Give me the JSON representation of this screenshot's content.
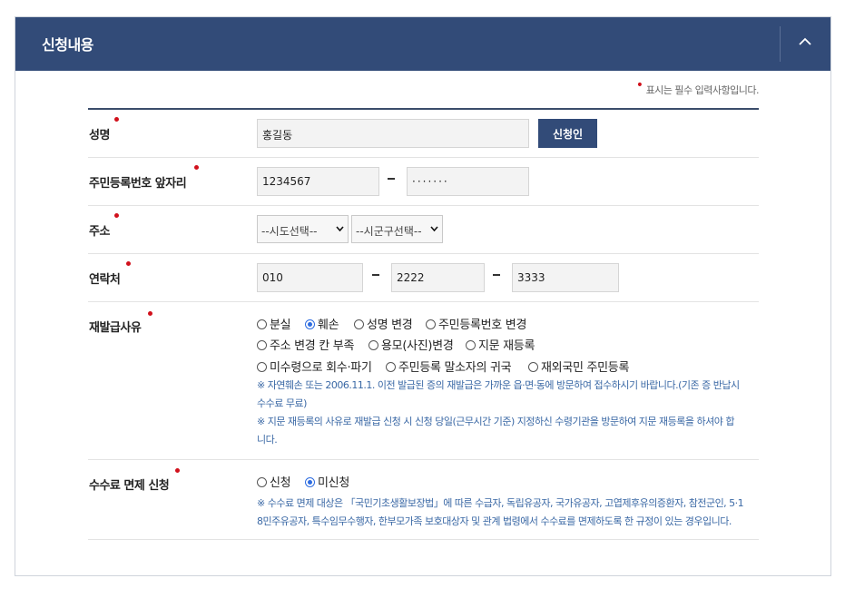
{
  "panel": {
    "title": "신청내용"
  },
  "required_note": "표시는 필수 입력사항입니다.",
  "fields": {
    "name": {
      "label": "성명",
      "value": "홍길동",
      "button": "신청인"
    },
    "rrn": {
      "label": "주민등록번호 앞자리",
      "front": "1234567",
      "back": "·······"
    },
    "address": {
      "label": "주소",
      "sido": "--시도선택--",
      "sigungu": "--시군구선택--"
    },
    "contact": {
      "label": "연락처",
      "part1": "010",
      "part2": "2222",
      "part3": "3333"
    },
    "reason": {
      "label": "재발급사유",
      "options": [
        "분실",
        "훼손",
        "성명 변경",
        "주민등록번호 변경",
        "주소 변경 칸 부족",
        "용모(사진)변경",
        "지문 재등록",
        "미수령으로 회수·파기",
        "주민등록 말소자의 귀국",
        "재외국민 주민등록"
      ],
      "selected": "훼손",
      "note1_line1": "※ 자연훼손 또는 2006.11.1. 이전 발급된 증의 재발급은 가까운 읍·면·동에 방문하여 접수하시기 바랍니다.(기존 증 반납시",
      "note1_line2": "수수료 무료)",
      "note2_line1": "※ 지문 재등록의 사유로 재발급 신청 시 신청 당일(근무시간 기준) 지정하신 수령기관을 방문하여 지문 재등록을 하셔야 합",
      "note2_line2": "니다."
    },
    "fee": {
      "label": "수수료 면제 신청",
      "options": [
        "신청",
        "미신청"
      ],
      "selected": "미신청",
      "note_line1": "※ 수수료 면제 대상은 「국민기초생활보장법」에 따른 수급자, 독립유공자, 국가유공자, 고엽제후유의증환자, 참전군인, 5·1",
      "note_line2": "8민주유공자, 특수임무수행자, 한부모가족 보호대상자 및 관계 법령에서 수수료를 면제하도록 한 규정이 있는 경우입니다."
    }
  },
  "colors": {
    "header": "#324b78",
    "required": "#d1111c",
    "note": "#3a68a5",
    "radio_selected": "#2d6ce0"
  }
}
